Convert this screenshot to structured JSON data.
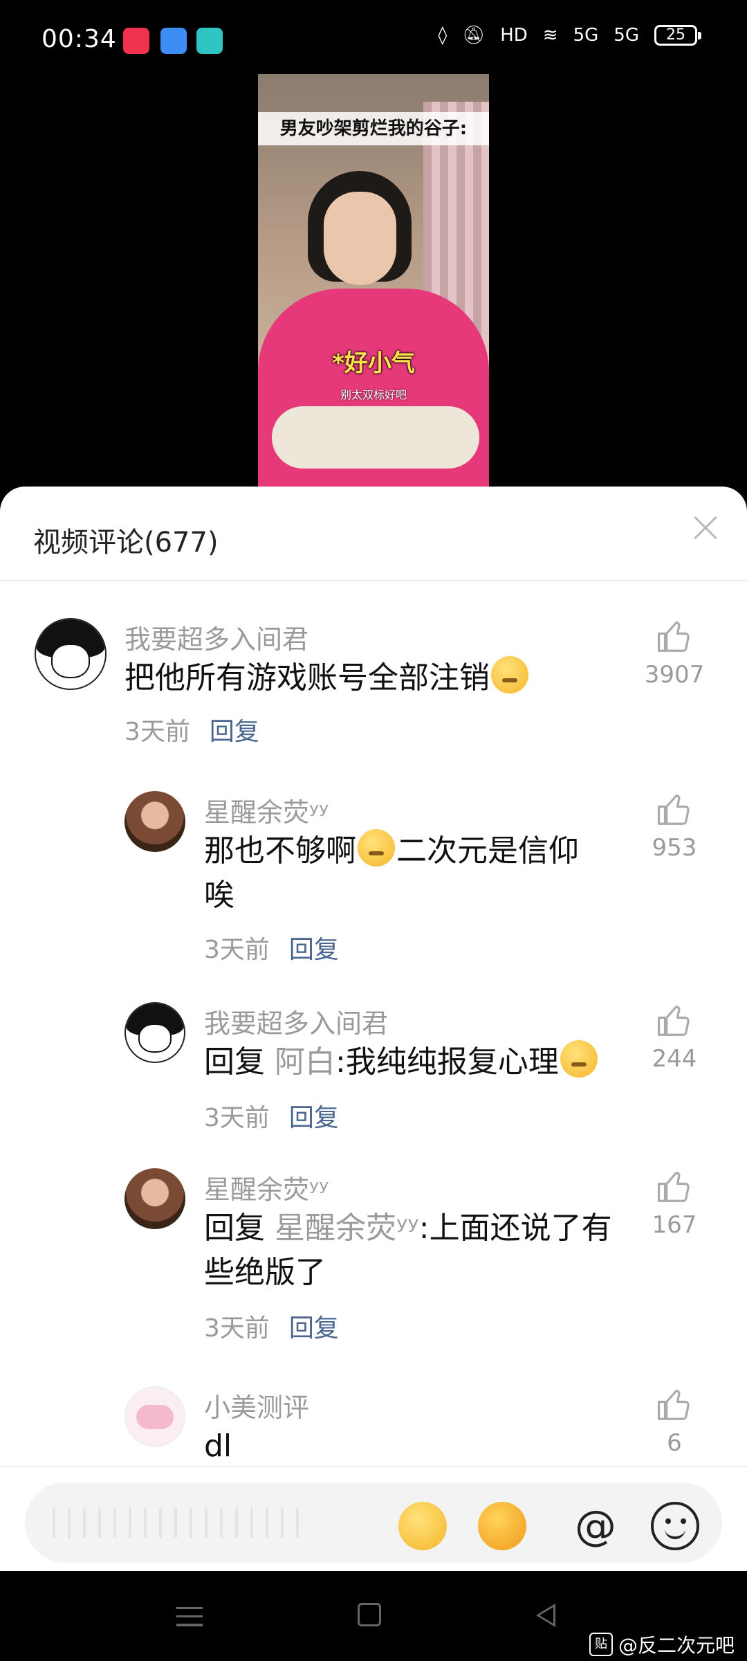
{
  "status_bar": {
    "time": "00:34",
    "hd_label": "HD",
    "net1": "5G",
    "net2": "5G",
    "battery": "25"
  },
  "video": {
    "caption": "男友吵架剪烂我的谷子:",
    "subtitle_big": "*好小气",
    "subtitle_small": "别太双标好吧"
  },
  "sheet": {
    "title": "视频评论(677)"
  },
  "comments": [
    {
      "user": "我要超多入间君",
      "text": "把他所有游戏账号全部注销",
      "emoji": "relieved",
      "time": "3天前",
      "reply": "回复",
      "likes": "3907"
    },
    {
      "user": "星醒余荧ʸʸ",
      "text_a": "那也不够啊",
      "emoji": "crying",
      "text_b": "二次元是信仰",
      "text_c": "唉",
      "time": "3天前",
      "reply": "回复",
      "likes": "953"
    },
    {
      "user": "我要超多入间君",
      "prefix": "回复",
      "target": "阿白",
      "text": ":我纯纯报复心理",
      "emoji": "kissing",
      "time": "3天前",
      "reply": "回复",
      "likes": "244"
    },
    {
      "user": "星醒余荧ʸʸ",
      "prefix": "回复",
      "target": "星醒余荧ʸʸ",
      "text_a": ":上面还说了有",
      "text_b": "些绝版了",
      "time": "3天前",
      "reply": "回复",
      "likes": "167"
    },
    {
      "user": "小美测评",
      "text": "dl",
      "likes": "6"
    }
  ],
  "input_bar": {
    "at_symbol": "@",
    "icons": [
      "laughing-tears-emoji",
      "grin-emoji",
      "at-icon",
      "smiley-icon"
    ]
  },
  "watermark": {
    "badge": "贴",
    "text": "@反二次元吧"
  }
}
